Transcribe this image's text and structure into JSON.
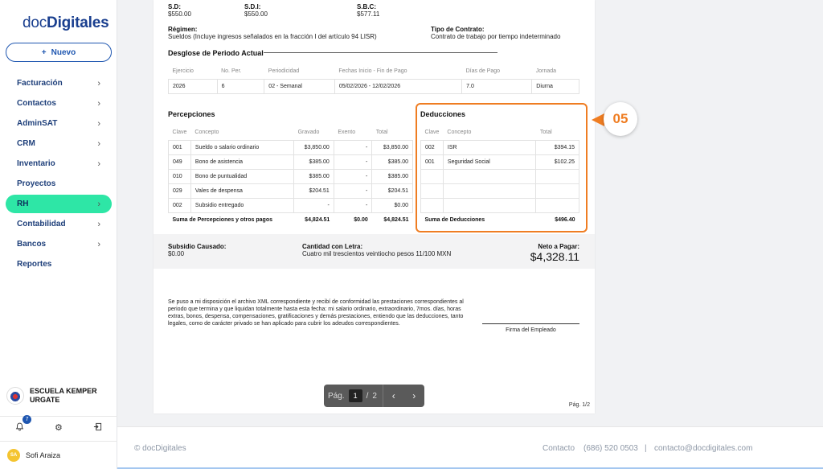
{
  "sidebar": {
    "logo_prefix": "doc",
    "logo_bold": "Digitales",
    "new_button": "Nuevo",
    "items": [
      {
        "label": "Facturación",
        "chevron": true
      },
      {
        "label": "Contactos",
        "chevron": true
      },
      {
        "label": "AdminSAT",
        "chevron": true
      },
      {
        "label": "CRM",
        "chevron": true
      },
      {
        "label": "Inventario",
        "chevron": true
      },
      {
        "label": "Proyectos",
        "chevron": false
      },
      {
        "label": "RH",
        "chevron": true,
        "active": true
      },
      {
        "label": "Contabilidad",
        "chevron": true
      },
      {
        "label": "Bancos",
        "chevron": true
      },
      {
        "label": "Reportes",
        "chevron": false
      }
    ],
    "org_name_line1": "ESCUELA KEMPER",
    "org_name_line2": "URGATE",
    "notifications_count": "7",
    "user_initials": "SA",
    "user_name": "Sofi Araiza"
  },
  "document": {
    "sd_label": "S.D:",
    "sd_value": "$550.00",
    "sdi_label": "S.D.I:",
    "sdi_value": "$550.00",
    "sbc_label": "S.B.C:",
    "sbc_value": "$577.11",
    "regimen_label": "Régimen:",
    "regimen_value": "Sueldos (Incluye ingresos señalados en la fracción I del artículo 94 LISR)",
    "contrato_label": "Tipo de Contrato:",
    "contrato_value": "Contrato de trabajo por tiempo indeterminado",
    "desglose_title": "Desglose de Periodo Actual",
    "periodo": {
      "headers": [
        "Ejercicio",
        "No. Per.",
        "Periodicidad",
        "Fechas Inicio - Fin de Pago",
        "Días de Pago",
        "Jornada"
      ],
      "row": [
        "2026",
        "6",
        "02 - Semanal",
        "05/02/2026 - 12/02/2026",
        "7.0",
        "Diurna"
      ]
    },
    "percepciones": {
      "title": "Percepciones",
      "headers": [
        "Clave",
        "Concepto",
        "Gravado",
        "Exento",
        "Total"
      ],
      "rows": [
        [
          "001",
          "Sueldo o salario ordinario",
          "$3,850.00",
          "-",
          "$3,850.00"
        ],
        [
          "049",
          "Bono de asistencia",
          "$385.00",
          "-",
          "$385.00"
        ],
        [
          "010",
          "Bono de puntualidad",
          "$385.00",
          "-",
          "$385.00"
        ],
        [
          "029",
          "Vales de despensa",
          "$204.51",
          "-",
          "$204.51"
        ],
        [
          "002",
          "Subsidio entregado",
          "-",
          "-",
          "$0.00"
        ]
      ],
      "footer_label": "Suma de Percepciones y otros pagos",
      "footer_gravado": "$4,824.51",
      "footer_exento": "$0.00",
      "footer_total": "$4,824.51"
    },
    "deducciones": {
      "title": "Deducciones",
      "headers": [
        "Clave",
        "Concepto",
        "Total"
      ],
      "rows": [
        [
          "002",
          "ISR",
          "$394.15"
        ],
        [
          "001",
          "Seguridad Social",
          "$102.25"
        ],
        [
          "",
          "",
          ""
        ],
        [
          "",
          "",
          ""
        ],
        [
          "",
          "",
          ""
        ]
      ],
      "footer_label": "Suma de Deducciones",
      "footer_total": "$496.40"
    },
    "callout_number": "05",
    "subsidio_label": "Subsidio Causado:",
    "subsidio_value": "$0.00",
    "cantidad_label": "Cantidad con Letra:",
    "cantidad_value": "Cuatro mil trescientos veintiocho pesos 11/100 MXN",
    "neto_label": "Neto a Pagar:",
    "neto_value": "$4,328.11",
    "legal_text": "Se puso a mi disposición el archivo XML correspondiente y recibí de conformidad las prestaciones correspondientes al periodo que termina y que liquidan totalmente hasta esta fecha: mi salario ordinario, extraordinario, 7mos. días, horas extras, bonos, despensa, compensaciones, gratificaciones y demás prestaciones, entiendo que las deducciones, tanto legales, como de carácter privado se han aplicado para cubrir los adeudos correspondientes.",
    "firma_label": "Firma del Empleado",
    "page_footer": "Pág. 1/2"
  },
  "pager": {
    "label": "Pág.",
    "current": "1",
    "separator": "/",
    "total": "2",
    "prev_icon": "‹",
    "next_icon": "›"
  },
  "footer": {
    "copyright": "© docDigitales",
    "contact_label": "Contacto",
    "phone": "(686) 520 0503",
    "separator": "|",
    "email": "contacto@docdigitales.com"
  }
}
